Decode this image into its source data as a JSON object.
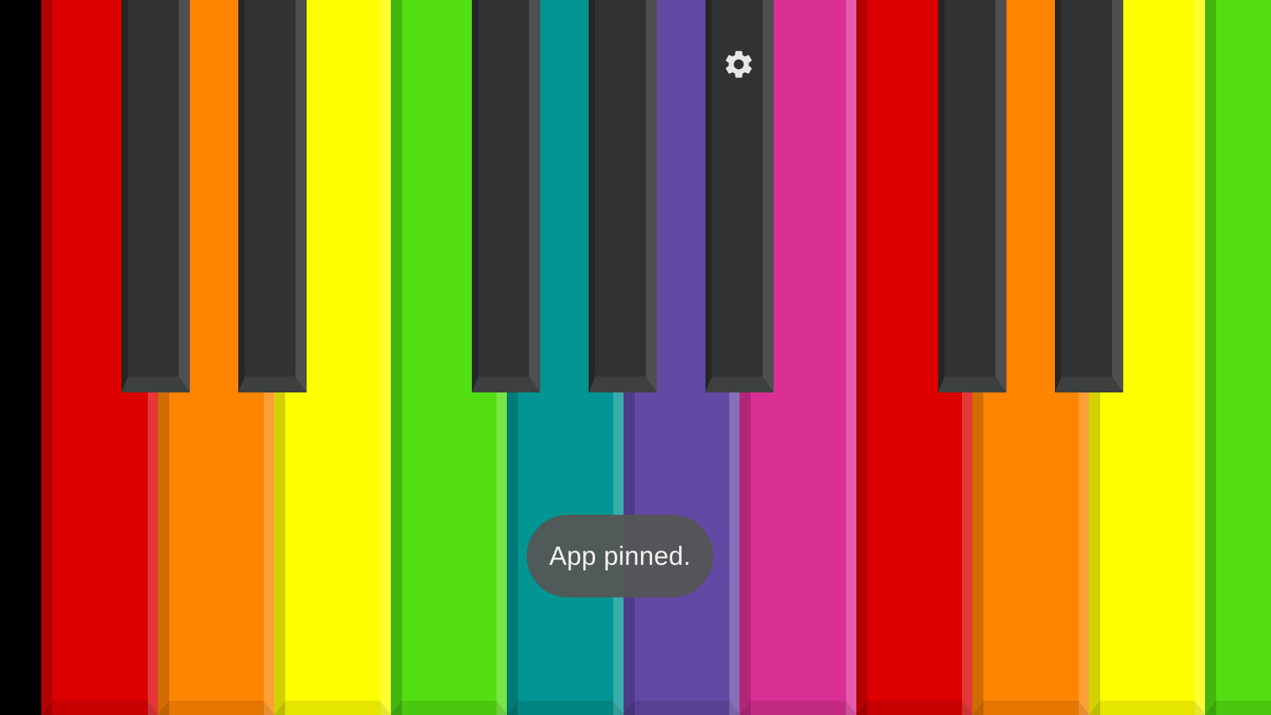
{
  "app": {
    "settings_icon": "gear-icon",
    "toast_text": "App pinned."
  },
  "keyboard": {
    "background_color": "#000000",
    "black_key_color": "#313332",
    "white_keys": [
      {
        "note": "C",
        "color": "#dd0000"
      },
      {
        "note": "D",
        "color": "#ff8400"
      },
      {
        "note": "E",
        "color": "#ffff00"
      },
      {
        "note": "F",
        "color": "#52de13"
      },
      {
        "note": "G",
        "color": "#009592"
      },
      {
        "note": "A",
        "color": "#6348a4"
      },
      {
        "note": "B",
        "color": "#da2f94"
      },
      {
        "note": "C",
        "color": "#dd0000"
      },
      {
        "note": "D",
        "color": "#ff8400"
      },
      {
        "note": "E",
        "color": "#ffff00"
      },
      {
        "note": "F",
        "color": "#52de13"
      }
    ],
    "black_keys": [
      "C#",
      "D#",
      "F#",
      "G#",
      "A#",
      "C#",
      "D#"
    ]
  }
}
